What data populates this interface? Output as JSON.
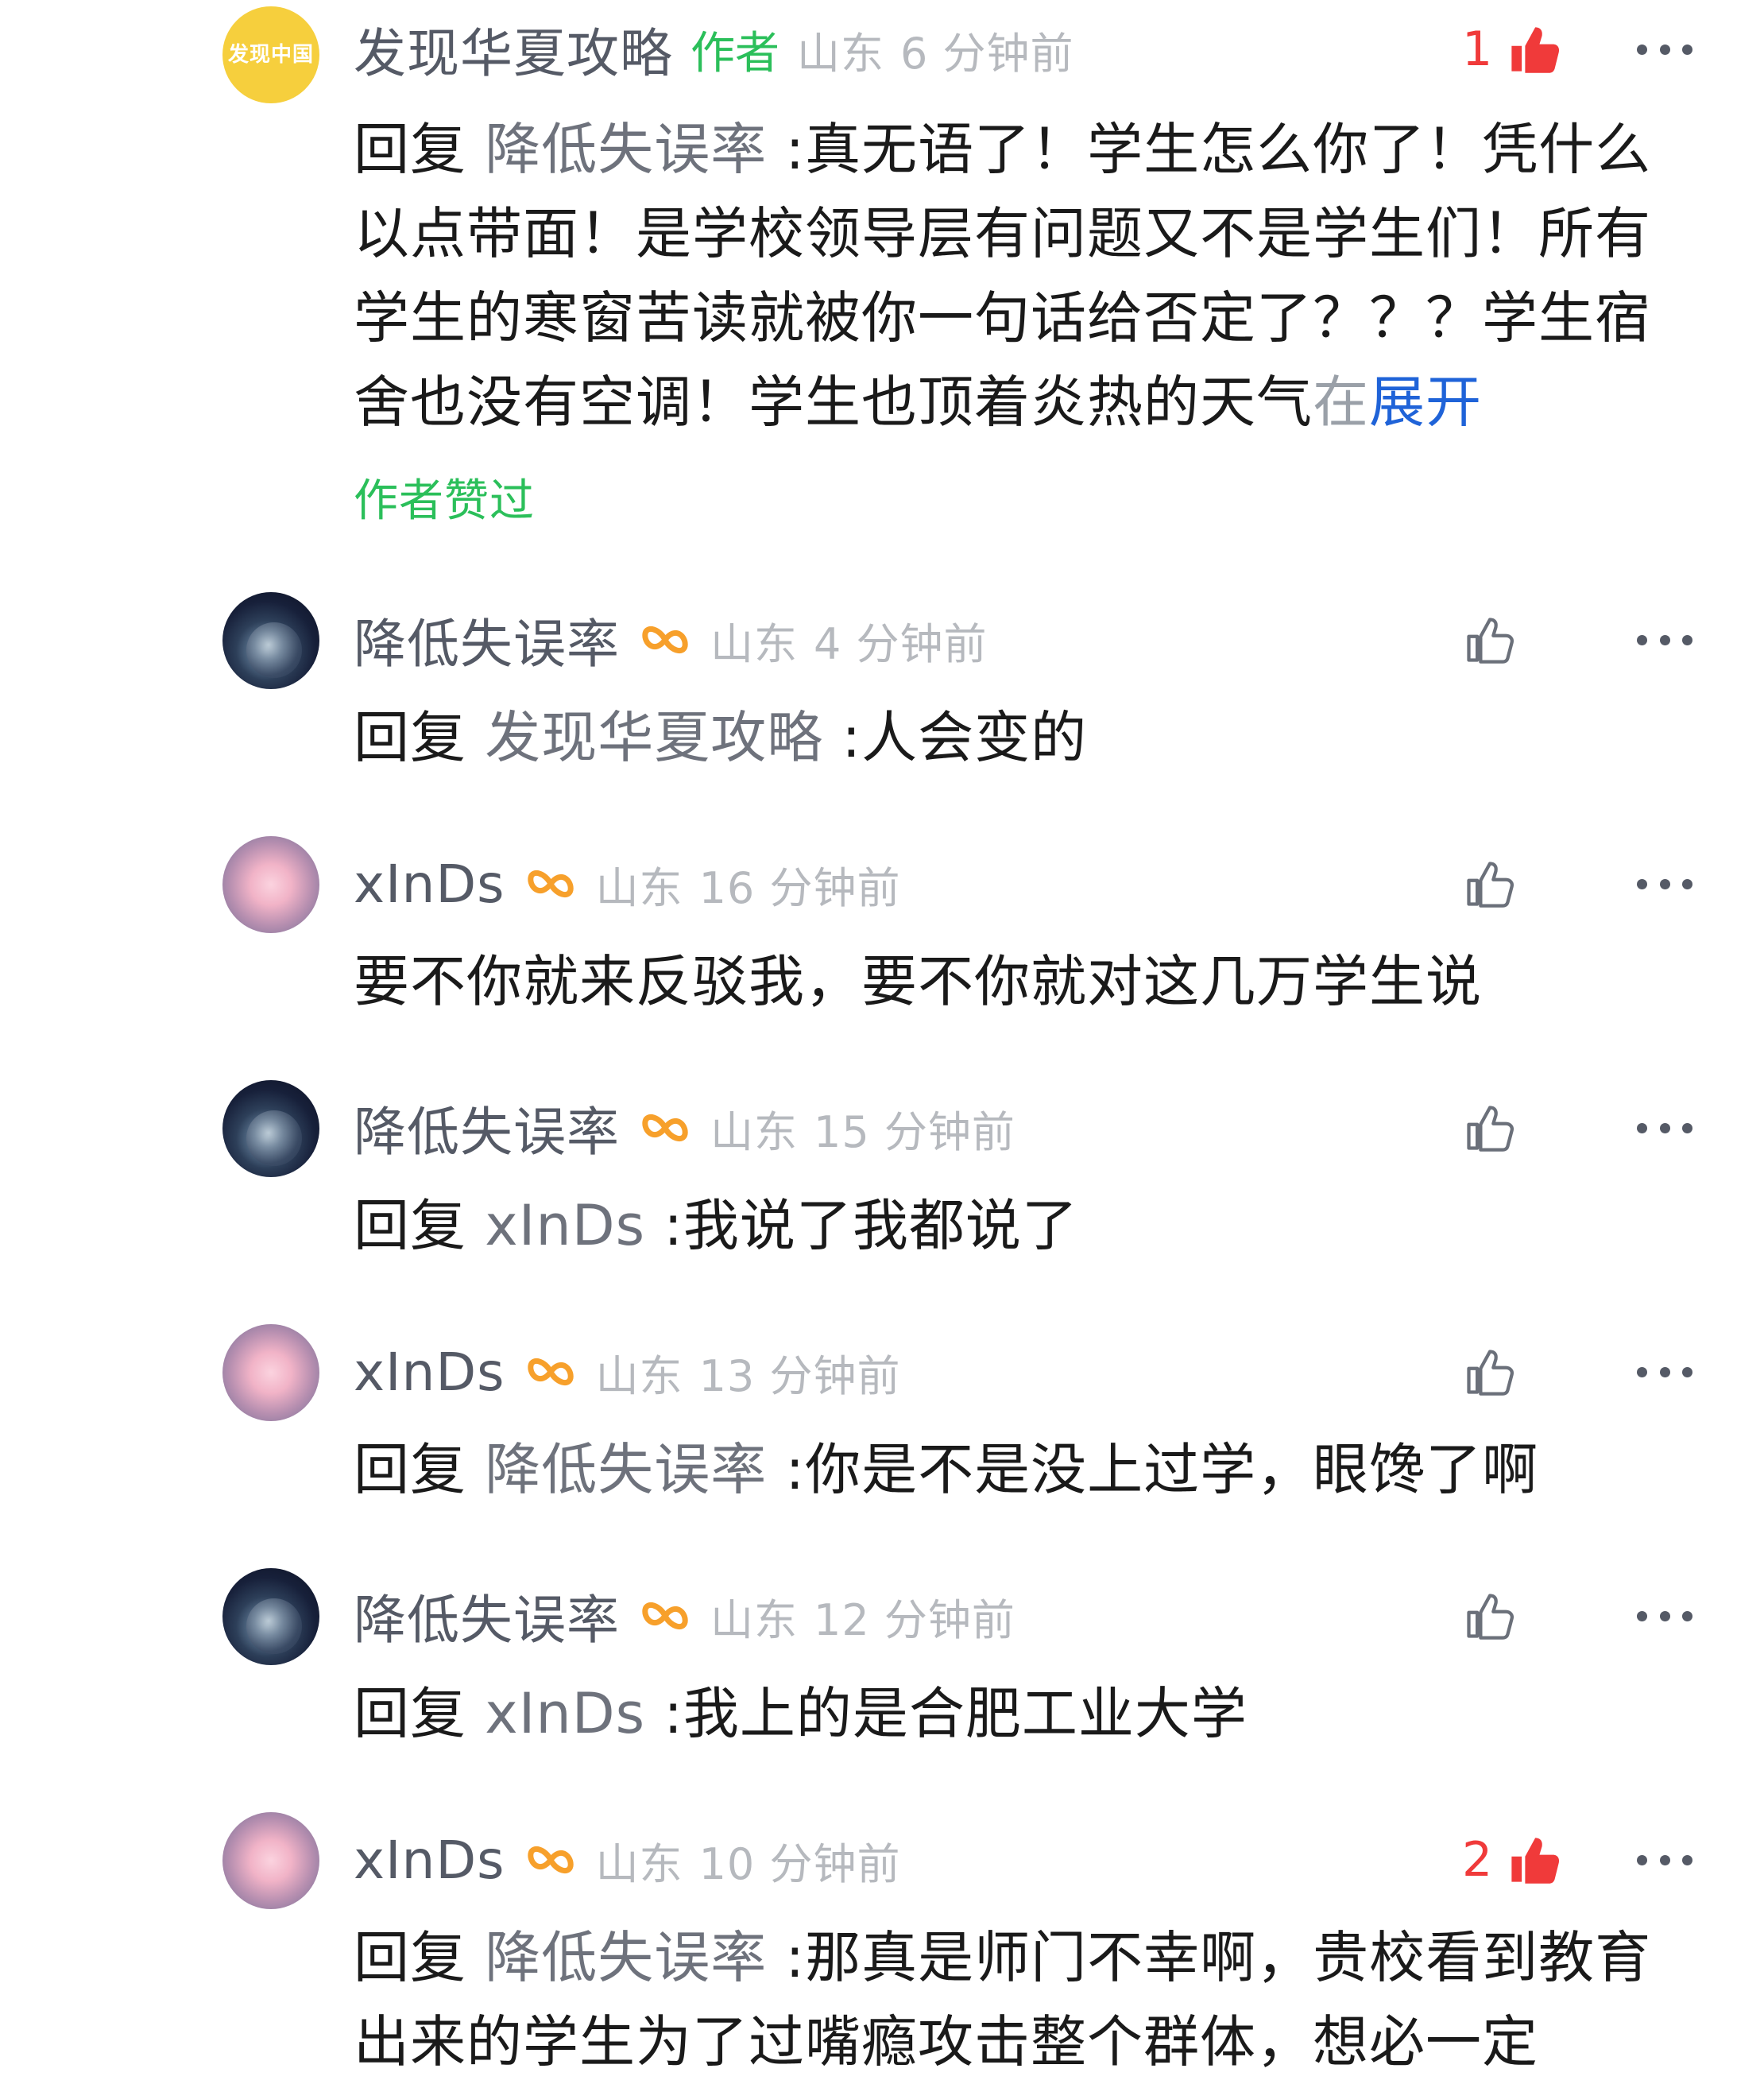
{
  "comments": [
    {
      "avatar_label": "发现中国",
      "username": "发现华夏攻略",
      "author_tag": "作者",
      "location": "山东",
      "time": "6 分钟前",
      "likes": "1",
      "reply_prefix": "回复",
      "reply_to": "降低失误率",
      "text": " :真无语了！学生怎么你了！凭什么以点带面！是学校领导层有问题又不是学生们！所有学生的寒窗苦读就被你一句话给否定了？？？学生宿舍也没有空调！学生也顶着炎热的天气",
      "text_faded": "在",
      "expand": "展开",
      "author_liked": "作者赞过"
    },
    {
      "username": "降低失误率",
      "location": "山东",
      "time": "4 分钟前",
      "reply_prefix": "回复",
      "reply_to": "发现华夏攻略",
      "text": " :人会变的"
    },
    {
      "username": "xInDs",
      "location": "山东",
      "time": "16 分钟前",
      "text": "要不你就来反驳我，要不你就对这几万学生说"
    },
    {
      "username": "降低失误率",
      "location": "山东",
      "time": "15 分钟前",
      "reply_prefix": "回复",
      "reply_to": "xInDs",
      "text": " :我说了我都说了"
    },
    {
      "username": "xInDs",
      "location": "山东",
      "time": "13 分钟前",
      "reply_prefix": "回复",
      "reply_to": "降低失误率",
      "text": " :你是不是没上过学，眼馋了啊"
    },
    {
      "username": "降低失误率",
      "location": "山东",
      "time": "12 分钟前",
      "reply_prefix": "回复",
      "reply_to": "xInDs",
      "text": " :我上的是合肥工业大学"
    },
    {
      "username": "xInDs",
      "location": "山东",
      "time": "10 分钟前",
      "likes": "2",
      "reply_prefix": "回复",
      "reply_to": "降低失误率",
      "text": " :那真是师门不幸啊，贵校看到教育出来的学生为了过嘴瘾攻击整个群体，想必一定"
    }
  ],
  "colors": {
    "author_green": "#2bbf5a",
    "like_red": "#f03a3a",
    "expand_blue": "#1f63d8",
    "badge_orange": "#f7a02b"
  },
  "icons": {
    "like": "thumbs-up-icon",
    "more": "more-dots-icon",
    "badge": "infinity-badge-icon"
  }
}
